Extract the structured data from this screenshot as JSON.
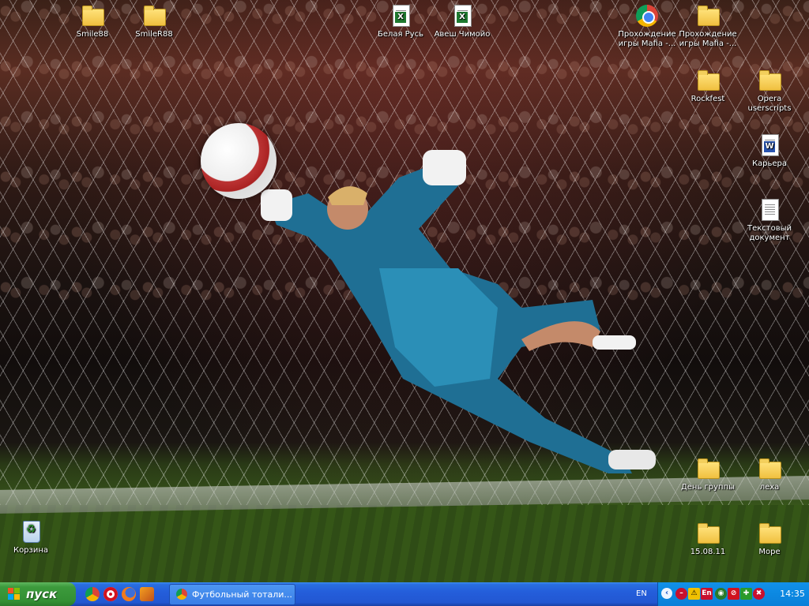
{
  "desktop": {
    "icons": [
      {
        "label": "Smile88",
        "type": "folder"
      },
      {
        "label": "SmileR88",
        "type": "folder"
      },
      {
        "label": "Белая Русь",
        "type": "excel-file"
      },
      {
        "label": "Авеш Чимойо",
        "type": "excel-file"
      },
      {
        "label": "Прохождение\nигры Mafia -...",
        "type": "chrome-shortcut"
      },
      {
        "label": "Прохождение\nигры Mafia -...",
        "type": "folder"
      },
      {
        "label": "Rockfest",
        "type": "folder"
      },
      {
        "label": "Opera\nuserscripts",
        "type": "folder"
      },
      {
        "label": "Карьера",
        "type": "word-file"
      },
      {
        "label": "Текстовый\nдокумент",
        "type": "text-file"
      },
      {
        "label": "День группы",
        "type": "folder"
      },
      {
        "label": "леха",
        "type": "folder"
      },
      {
        "label": "Корзина",
        "type": "recycle-bin"
      },
      {
        "label": "15.08.11",
        "type": "folder"
      },
      {
        "label": "Море",
        "type": "folder"
      }
    ]
  },
  "taskbar": {
    "start_label": "пуск",
    "quick_launch": [
      "chrome-icon",
      "opera-icon",
      "firefox-icon",
      "winamp-icon"
    ],
    "tasks": [
      {
        "title": "Футбольный тотали..."
      }
    ],
    "language": "EN",
    "tray_lang_badge": "En",
    "clock": "14:35"
  },
  "colors": {
    "taskbar": "#245edb",
    "start": "#3c9a3c",
    "tray": "#0d8ae3"
  }
}
